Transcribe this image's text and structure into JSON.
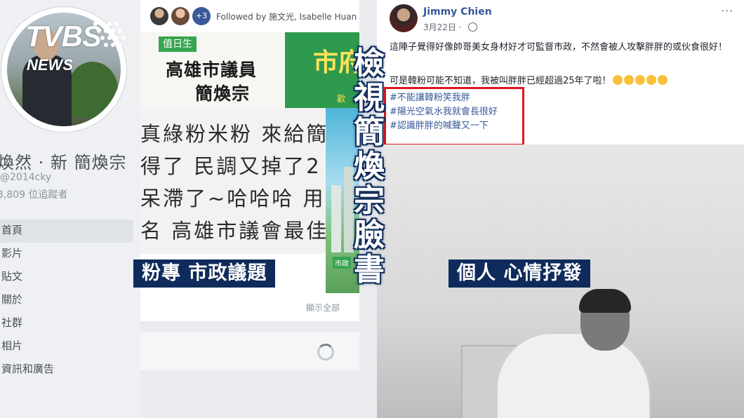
{
  "watermark": {
    "logo_text": "TVBS",
    "logo_sub": "NEWS"
  },
  "left_page": {
    "name": "煥然 · 新 簡煥宗",
    "handle": "@2014cky",
    "followers": "3,809 位追蹤者",
    "nav": [
      "首頁",
      "影片",
      "貼文",
      "關於",
      "社群",
      "相片",
      "資訊和廣告"
    ]
  },
  "mid_post": {
    "followed_by": "Followed by 施文光, Isabelle Huan",
    "banner_tag": "值日生",
    "banner_title_1": "高雄市議員",
    "banner_title_2": "簡煥宗",
    "banner_right": "市府",
    "banner_right_small": "歡",
    "text_lines": [
      "真綠粉米粉 來給簡",
      "得了 民調又掉了2",
      "呆滯了~哈哈哈 用到",
      "名 高雄市議會最佳"
    ],
    "side_sticker": "市政",
    "see_more": "顯示全部",
    "fav3_icon": "+3"
  },
  "caption_left": "粉專 市政議題",
  "caption_right": "個人 心情抒發",
  "vertical_title": "檢視簡煥宗臉書",
  "right_post": {
    "author": "Jimmy Chien",
    "date": "3月22日 ·",
    "more_icon": "···",
    "body_1": "這陣子覺得好像帥哥美女身材好才可監督市政，不然會被人攻擊胖胖的或伙食很好！",
    "body_2": "可是韓粉可能不知道，我被叫胖胖已經超過25年了啦！",
    "hashtags": [
      "#不能讓韓粉笑我胖",
      "#陽光空氣水我就會長很好",
      "#認識胖胖的喊聲又一下"
    ]
  },
  "colors": {
    "caption_bg": "#0f2b5b",
    "highlight_box": "#e0131e",
    "fb_link": "#365899",
    "banner_green": "#2e9a4e"
  }
}
